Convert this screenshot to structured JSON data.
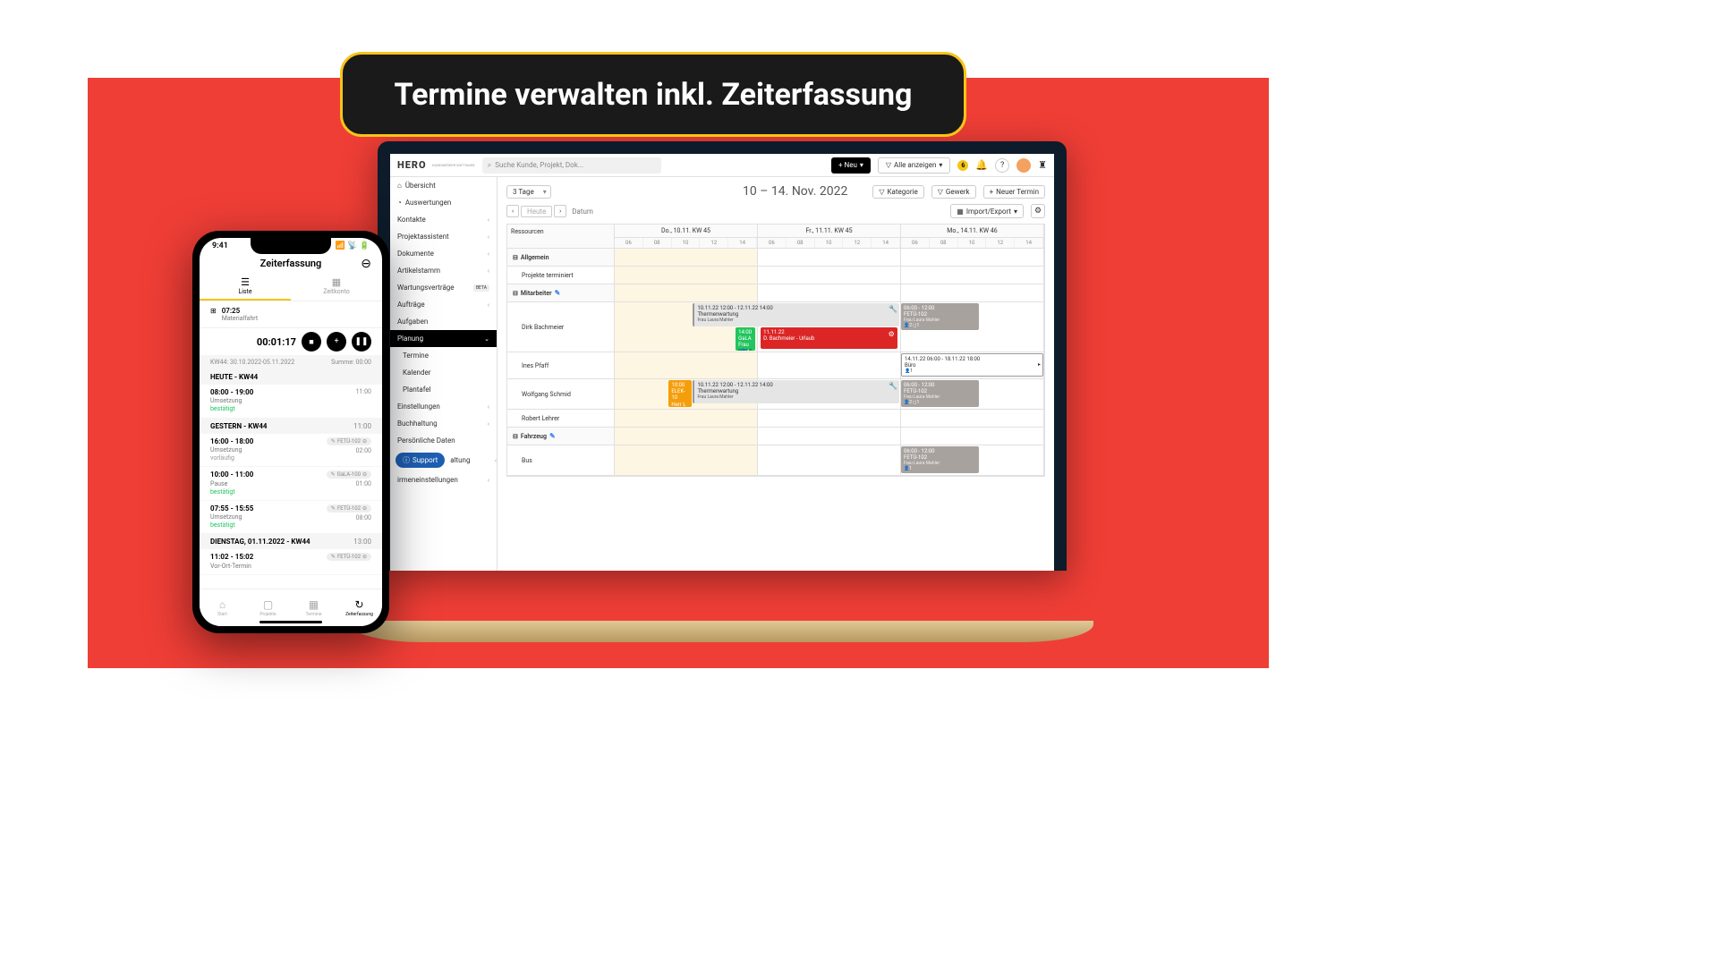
{
  "banner": "Termine verwalten inkl. Zeiterfassung",
  "app": {
    "logo": "HERO",
    "logo_sub": "HANDWERKER SOFTWARE",
    "search_placeholder": "Suche Kunde, Projekt, Dok...",
    "btn_new": "+ Neu",
    "btn_showall": "Alle anzeigen",
    "badge": "6"
  },
  "sidebar": {
    "uebersicht": "Übersicht",
    "auswertungen": "Auswertungen",
    "kontakte": "Kontakte",
    "projektassistent": "Projektassistent",
    "dokumente": "Dokumente",
    "artikelstamm": "Artikelstamm",
    "wartung": "Wartungsverträge",
    "beta": "BETA",
    "auftraege": "Aufträge",
    "aufgaben": "Aufgaben",
    "planung": "Planung",
    "termine": "Termine",
    "kalender": "Kalender",
    "plantafel": "Plantafel",
    "einstellungen": "Einstellungen",
    "buchhaltung": "Buchhaltung",
    "persdaten": "Persönliche Daten",
    "verwaltung_suffix": "altung",
    "firmen_suffix": "irmeneinstellungen",
    "support": "Support"
  },
  "toolbar": {
    "range": "3 Tage",
    "heute": "Heute",
    "datum": "Datum",
    "kategorie": "Kategorie",
    "gewerk": "Gewerk",
    "neuer_termin": "Neuer Termin",
    "import_export": "Import/Export",
    "big_date": "10 – 14. Nov. 2022"
  },
  "schedule": {
    "ressourcen": "Ressourcen",
    "days": [
      "Do., 10.11. KW 45",
      "Fr., 11.11. KW 45",
      "Mo., 14.11. KW 46"
    ],
    "hours": [
      "06",
      "08",
      "10",
      "12",
      "14"
    ],
    "group_allgemein": "Allgemein",
    "projekte_term": "Projekte terminiert",
    "group_mitarbeiter": "Mitarbeiter",
    "dirk": "Dirk Bachmeier",
    "ines": "Ines Pfaff",
    "wolfgang": "Wolfgang Schmid",
    "robert": "Robert Lehrer",
    "group_fahrzeug": "Fahrzeug",
    "bus": "Bus",
    "evt_thermen_time": "10.11.22 12:00 - 12.11.22 14:00",
    "evt_thermen_title": "Thermenwartung",
    "evt_laura": "Frau Laura Mahler",
    "evt_green_time": "14:00",
    "evt_green_l2": "GaLA",
    "evt_green_l3": "Frau",
    "evt_green_badge": "1",
    "evt_urlaub_date": "11.11.22",
    "evt_urlaub": "D. Bachmeier - Urlaub",
    "evt_fetu_time": "06:00 - 12:00",
    "evt_fetu": "FETÜ-102",
    "evt_fetu_badge": "2",
    "evt_buero_time": "14.11.22 06:00 - 18.11.22 18:00",
    "evt_buero": "Büro",
    "evt_buero_badge": "1",
    "evt_elek_time": "10:00",
    "evt_elek": "ELEK-10",
    "evt_elek_l3": "Herr L",
    "evt_elek_badge": "1",
    "evt_wolf_badge2": "2",
    "evt_bus_badge": "1"
  },
  "phone": {
    "time": "9:41",
    "title": "Zeiterfassung",
    "tab_liste": "Liste",
    "tab_zeitkonto": "Zeitkonto",
    "task_icon_label": "⊞",
    "task_time": "07:25",
    "task_name": "Materialfahrt",
    "timer": "00:01:17",
    "range_label": "KW44: 30.10.2022-05.11.2022",
    "range_sum": "Summe: 00:00",
    "sec_heute": "HEUTE - KW44",
    "e1_time": "08:00 - 19:00",
    "e1_sub": "Umsetzung",
    "e1_st": "bestätigt",
    "e1_r": "11:00",
    "sec_gestern": "GESTERN - KW44",
    "sec_gestern_r": "11:00",
    "e2_time": "16:00 - 18:00",
    "e2_sub": "Umsetzung",
    "e2_st": "vorläufig",
    "e2_pill": "FETÜ-102",
    "e2_r": "02:00",
    "e3_time": "10:00 - 11:00",
    "e3_sub": "Pause",
    "e3_st": "bestätigt",
    "e3_pill": "GaLA-100",
    "e3_r": "01:00",
    "e4_time": "07:55 - 15:55",
    "e4_sub": "Umsetzung",
    "e4_st": "bestätigt",
    "e4_pill": "FETÜ-102",
    "e4_r": "08:00",
    "sec_dienstag": "DIENSTAG, 01.11.2022 - KW44",
    "sec_dienstag_r": "13:00",
    "e5_time": "11:02 - 15:02",
    "e5_sub": "Vor-Ort-Termin",
    "e5_pill": "FETÜ-102",
    "nav_start": "Start",
    "nav_projekte": "Projekte",
    "nav_termine": "Termine",
    "nav_zeit": "Zeiterfassung"
  }
}
